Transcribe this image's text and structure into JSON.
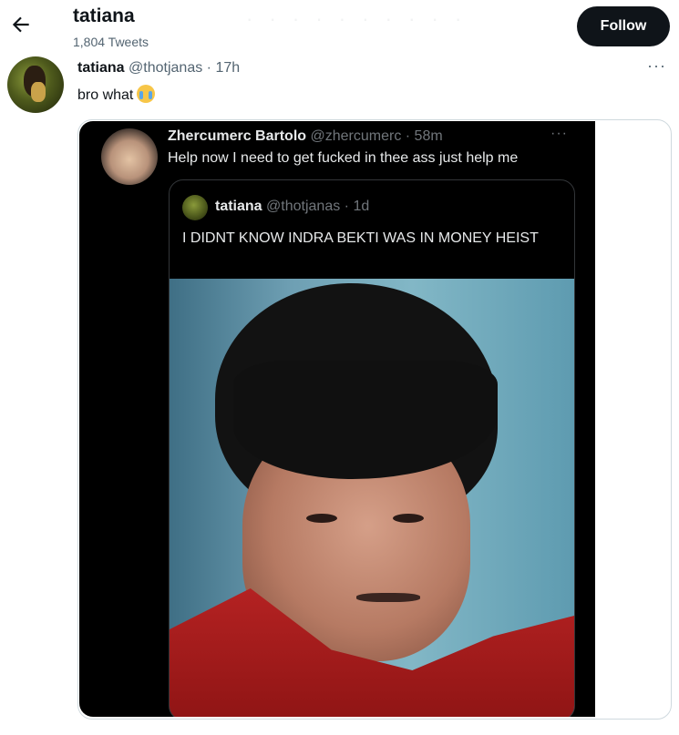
{
  "header": {
    "title": "tatiana",
    "tweet_count": "1,804 Tweets",
    "follow_label": "Follow"
  },
  "tweet": {
    "display_name": "tatiana",
    "handle": "@thotjanas",
    "time": "· 17h",
    "text": "bro what",
    "emoji": "loudly-crying-face",
    "more": "···"
  },
  "embedded": {
    "display_name": "Zhercumerc Bartolo",
    "handle": "@zhercumerc",
    "time": "· 58m",
    "text": "Help now I need to get fucked in thee ass just help me",
    "more": "···",
    "quote": {
      "display_name": "tatiana",
      "handle": "@thotjanas",
      "time": "· 1d",
      "text": "I DIDNT KNOW INDRA BEKTI WAS IN MONEY HEIST"
    }
  },
  "colors": {
    "text": "#0f1419",
    "muted": "#536471",
    "follow_bg": "#0f1419",
    "dark_bg": "#000000"
  }
}
